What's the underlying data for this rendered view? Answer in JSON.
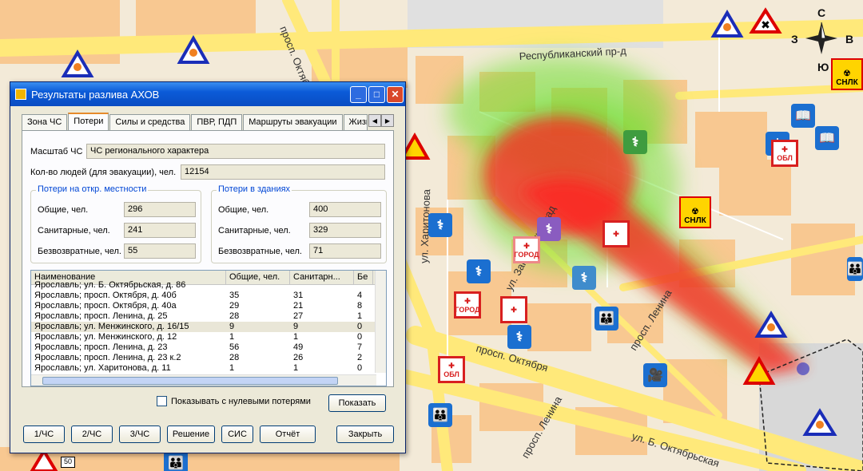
{
  "map": {
    "street_labels": [
      "Республиканский пр-д",
      "просп. Октября",
      "ул. Загородный сад",
      "просп. Ленина",
      "просп. Октября",
      "просп. Ленина",
      "ул. Б. Октябрьская",
      "ул. Харитонова",
      "просп. Октября"
    ],
    "compass": {
      "n": "С",
      "s": "Ю",
      "w": "З",
      "e": "В"
    },
    "snlk_label": "СНЛК",
    "obl_label": "ОБЛ",
    "gorod_label": "ГОРОД",
    "road_sign": "50",
    "colors": {
      "plume_red": "#ff2020",
      "plume_green": "#44e020",
      "water": "#ffffff",
      "road": "#ffe97a",
      "building": "#f8c890"
    }
  },
  "dialog": {
    "title": "Результаты разлива АХОВ",
    "tabs": [
      "Зона ЧС",
      "Потери",
      "Силы и средства",
      "ПВР, ПДП",
      "Маршруты эвакуации",
      "Жизнеоб"
    ],
    "active_tab": "Потери",
    "scale_label": "Масштаб ЧС",
    "scale_value": "ЧС регионального характера",
    "people_label": "Кол-во людей (для эвакуации), чел.",
    "people_value": "12154",
    "open_group": {
      "title": "Потери на откр. местности",
      "total_label": "Общие, чел.",
      "total_value": "296",
      "sanitary_label": "Санитарные, чел.",
      "sanitary_value": "241",
      "irrevocable_label": "Безвозвратные, чел.",
      "irrevocable_value": "55"
    },
    "building_group": {
      "title": "Потери в зданиях",
      "total_label": "Общие, чел.",
      "total_value": "400",
      "sanitary_label": "Санитарные, чел.",
      "sanitary_value": "329",
      "irrevocable_label": "Безвозвратные, чел.",
      "irrevocable_value": "71"
    },
    "table": {
      "headers": [
        "Наименование",
        "Общие, чел.",
        "Санитарн...",
        "Бе"
      ],
      "rows": [
        [
          "Ярославль; ул. Б. Октябрьская, д. 86",
          "",
          "",
          ""
        ],
        [
          "Ярославль; просп. Октября, д. 40б",
          "35",
          "31",
          "4"
        ],
        [
          "Ярославль; просп. Октября, д. 40а",
          "29",
          "21",
          "8"
        ],
        [
          "Ярославль; просп. Ленина, д. 25",
          "28",
          "27",
          "1"
        ],
        [
          "Ярославль; ул. Менжинского, д. 16/15",
          "9",
          "9",
          "0"
        ],
        [
          "Ярославль; ул. Менжинского, д. 12",
          "1",
          "1",
          "0"
        ],
        [
          "Ярославль; просп. Ленина, д. 23",
          "56",
          "49",
          "7"
        ],
        [
          "Ярославль; просп. Ленина, д. 23 к.2",
          "28",
          "26",
          "2"
        ],
        [
          "Ярославль; ул. Харитонова, д. 11",
          "1",
          "1",
          "0"
        ]
      ],
      "selected_index": 4
    },
    "show_zero_label": "Показывать с нулевыми потерями",
    "show_button": "Показать",
    "bottom_buttons": [
      "1/ЧС",
      "2/ЧС",
      "3/ЧС",
      "Решение",
      "СИС",
      "Отчёт",
      "Закрыть"
    ]
  }
}
